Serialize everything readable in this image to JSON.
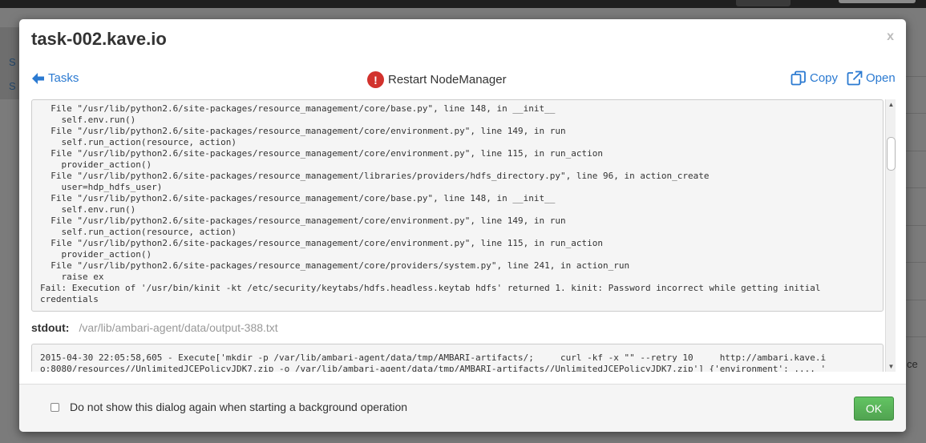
{
  "background": {
    "left_items": [
      "S",
      "S"
    ],
    "right_text": "ce"
  },
  "modal": {
    "title": "task-002.kave.io",
    "close_label": "x"
  },
  "task_bar": {
    "back_label": "Tasks",
    "task_name": "Restart NodeManager",
    "status_icon": "!",
    "copy_label": "Copy",
    "open_label": "Open"
  },
  "stderr_log": "    - ^                                   ^\n  File \"/usr/lib/python2.6/site-packages/resource_management/core/base.py\", line 148, in __init__\n    self.env.run()\n  File \"/usr/lib/python2.6/site-packages/resource_management/core/environment.py\", line 149, in run\n    self.run_action(resource, action)\n  File \"/usr/lib/python2.6/site-packages/resource_management/core/environment.py\", line 115, in run_action\n    provider_action()\n  File \"/usr/lib/python2.6/site-packages/resource_management/libraries/providers/hdfs_directory.py\", line 96, in action_create\n    user=hdp_hdfs_user)\n  File \"/usr/lib/python2.6/site-packages/resource_management/core/base.py\", line 148, in __init__\n    self.env.run()\n  File \"/usr/lib/python2.6/site-packages/resource_management/core/environment.py\", line 149, in run\n    self.run_action(resource, action)\n  File \"/usr/lib/python2.6/site-packages/resource_management/core/environment.py\", line 115, in run_action\n    provider_action()\n  File \"/usr/lib/python2.6/site-packages/resource_management/core/providers/system.py\", line 241, in action_run\n    raise ex\nFail: Execution of '/usr/bin/kinit -kt /etc/security/keytabs/hdfs.headless.keytab hdfs' returned 1. kinit: Password incorrect while getting initial\ncredentials",
  "stdout": {
    "label": "stdout:",
    "path": "/var/lib/ambari-agent/data/output-388.txt",
    "log": "2015-04-30 22:05:58,605 - Execute['mkdir -p /var/lib/ambari-agent/data/tmp/AMBARI-artifacts/;     curl -kf -x \"\" --retry 10     http://ambari.kave.i\no:8080/resources//UnlimitedJCEPolicyJDK7.zip -o /var/lib/ambari-agent/data/tmp/AMBARI-artifacts//UnlimitedJCEPolicyJDK7.zip'] {'environment': ..., '"
  },
  "footer": {
    "checkbox_label": "Do not show this dialog again when starting a background operation",
    "checkbox_checked": false,
    "ok_label": "OK"
  },
  "colors": {
    "link": "#2b7ad1",
    "error": "#d2322d",
    "ok_button": "#5bb75b"
  }
}
